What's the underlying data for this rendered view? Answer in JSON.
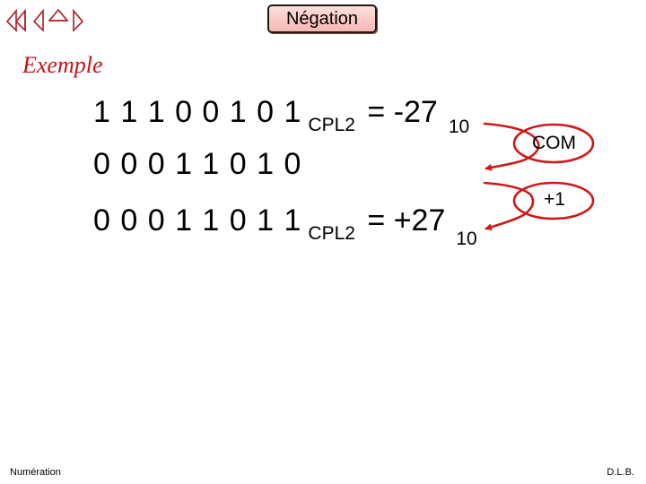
{
  "nav": {
    "icons": [
      "first-slide-icon",
      "previous-slide-icon",
      "home-icon",
      "next-slide-icon"
    ],
    "color": "#b01a24"
  },
  "title": "Négation",
  "heading": "Exemple",
  "lines": [
    {
      "bits": "1 1 1 0 0 1 0 1",
      "subscript": "CPL2",
      "equation": "= -27",
      "base": "10"
    },
    {
      "bits": "0 0 0 1 1 0 1 0"
    },
    {
      "bits": "0 0 0 1 1 0 1 1",
      "subscript": "CPL2",
      "equation": "= +27",
      "base": "10"
    }
  ],
  "operations": [
    {
      "label": "COM",
      "meaning": "complement"
    },
    {
      "label": "+1",
      "meaning": "add one"
    }
  ],
  "colors": {
    "accent": "#c0141c",
    "loop": "#cc1a1a",
    "title_bg": "#f7b8b0"
  },
  "footer": {
    "left": "Numération",
    "right": "D.L.B."
  }
}
